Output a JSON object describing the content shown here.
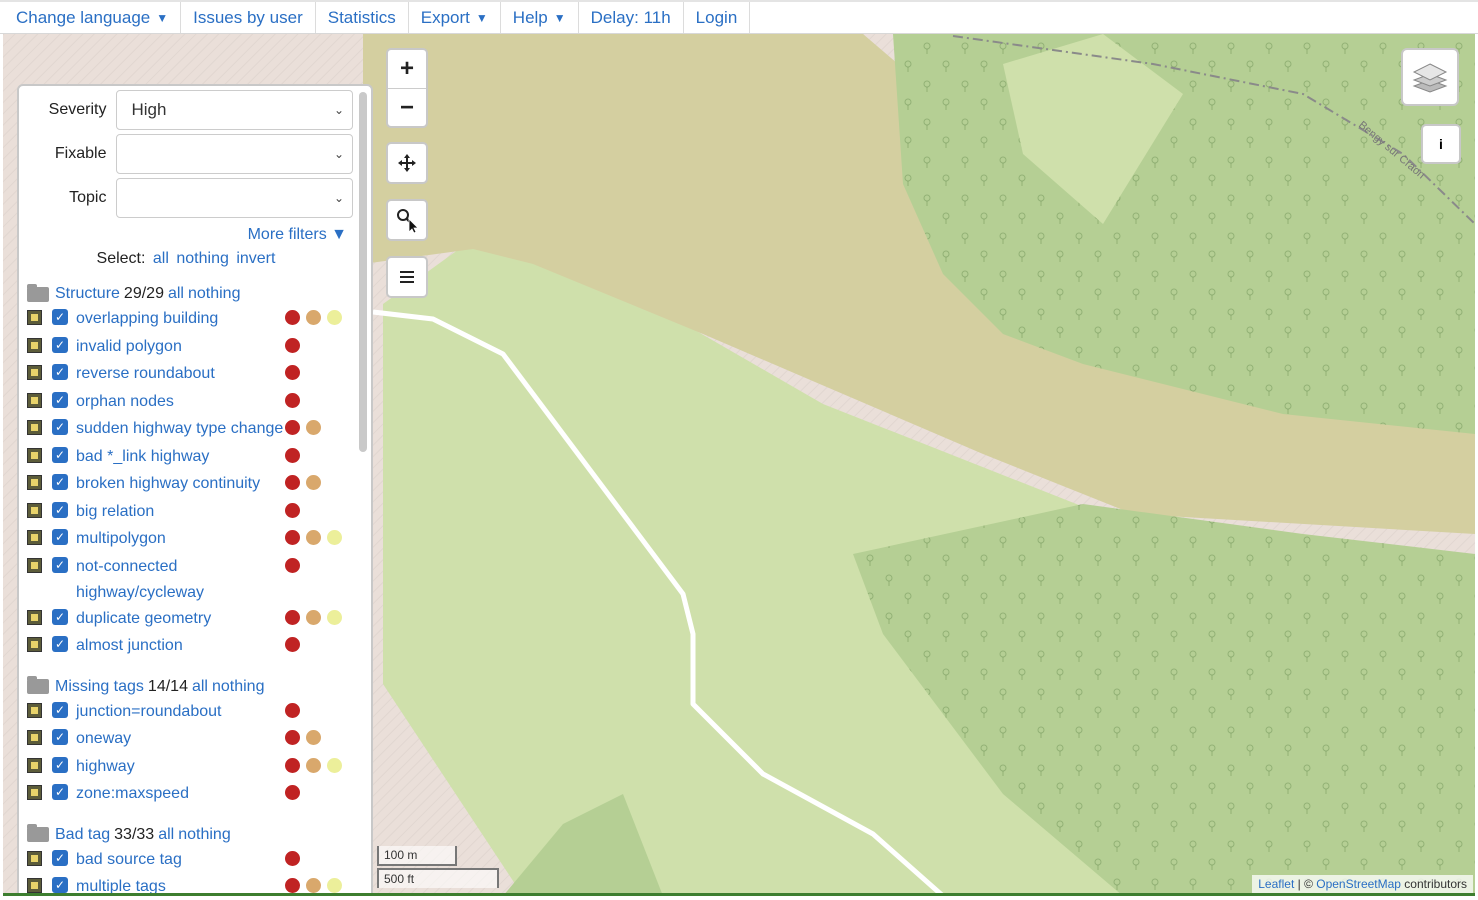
{
  "menu": [
    {
      "label": "Change language",
      "arrow": "▼"
    },
    {
      "label": "Issues by user",
      "arrow": ""
    },
    {
      "label": "Statistics",
      "arrow": ""
    },
    {
      "label": "Export",
      "arrow": "▼"
    },
    {
      "label": "Help",
      "arrow": "▼"
    },
    {
      "label": "Delay: 11h",
      "arrow": ""
    },
    {
      "label": "Login",
      "arrow": ""
    }
  ],
  "filters": {
    "severity_label": "Severity",
    "severity_value": "High",
    "fixable_label": "Fixable",
    "fixable_value": "",
    "topic_label": "Topic",
    "topic_value": "",
    "more_filters": "More filters ▼",
    "select_label": "Select:",
    "select_all": "all",
    "select_nothing": "nothing",
    "select_invert": "invert"
  },
  "categories": [
    {
      "name": "Structure",
      "count": "29/29",
      "all": "all",
      "nothing": "nothing",
      "items": [
        {
          "label": "overlapping building",
          "levels": [
            "high",
            "mid",
            "low"
          ]
        },
        {
          "label": "invalid polygon",
          "levels": [
            "high"
          ]
        },
        {
          "label": "reverse roundabout",
          "levels": [
            "high"
          ]
        },
        {
          "label": "orphan nodes",
          "levels": [
            "high"
          ]
        },
        {
          "label": "sudden highway type change",
          "levels": [
            "high",
            "mid"
          ]
        },
        {
          "label": "bad *_link highway",
          "levels": [
            "high"
          ]
        },
        {
          "label": "broken highway continuity",
          "levels": [
            "high",
            "mid"
          ]
        },
        {
          "label": "big relation",
          "levels": [
            "high"
          ]
        },
        {
          "label": "multipolygon",
          "levels": [
            "high",
            "mid",
            "low"
          ]
        },
        {
          "label": "not-connected highway/cycleway",
          "levels": [
            "high"
          ]
        },
        {
          "label": "duplicate geometry",
          "levels": [
            "high",
            "mid",
            "low"
          ]
        },
        {
          "label": "almost junction",
          "levels": [
            "high"
          ]
        }
      ]
    },
    {
      "name": "Missing tags",
      "count": "14/14",
      "all": "all",
      "nothing": "nothing",
      "items": [
        {
          "label": "junction=roundabout",
          "levels": [
            "high"
          ]
        },
        {
          "label": "oneway",
          "levels": [
            "high",
            "mid"
          ]
        },
        {
          "label": "highway",
          "levels": [
            "high",
            "mid",
            "low"
          ]
        },
        {
          "label": "zone:maxspeed",
          "levels": [
            "high"
          ]
        }
      ]
    },
    {
      "name": "Bad tag",
      "count": "33/33",
      "all": "all",
      "nothing": "nothing",
      "items": [
        {
          "label": "bad source tag",
          "levels": [
            "high"
          ]
        },
        {
          "label": "multiple tags",
          "levels": [
            "high",
            "mid",
            "low"
          ]
        }
      ]
    }
  ],
  "map": {
    "zoom_in": "+",
    "zoom_out": "−",
    "move_icon": "move-icon",
    "search_icon": "search-icon",
    "menu_icon": "list-icon",
    "info_label": "i",
    "road_label": "Bengy sur Craon",
    "scale_m": "100 m",
    "scale_ft": "500 ft",
    "attribution_leaflet": "Leaflet",
    "attribution_sep": " | © ",
    "attribution_osm": "OpenStreetMap",
    "attribution_tail": " contributors"
  },
  "colors": {
    "link": "#2a6fc4",
    "severity_high": "#c02323",
    "severity_mid": "#d9a86c",
    "severity_low": "#ecef9a",
    "forest": "#b5cf94",
    "meadow": "#cfe0ab",
    "farmland": "#d4cfa0",
    "residential": "#eadfd9"
  }
}
